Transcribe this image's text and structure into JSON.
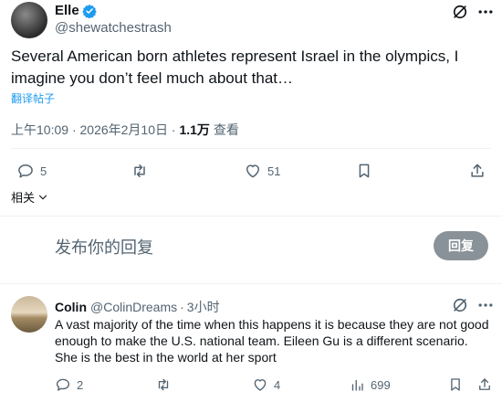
{
  "colors": {
    "accent": "#1d9bf0",
    "text": "#0f1419",
    "muted": "#536471",
    "divider": "#eff3f4",
    "reply_btn": "#8a9299"
  },
  "post": {
    "display_name": "Elle",
    "handle": "@shewatchestrash",
    "verified_icon": "verified-badge-icon",
    "text": "Several American born athletes represent Israel in the olympics, I imagine you don’t feel much about that…",
    "translate_label": "翻译帖子",
    "time": "上午10:09",
    "date": "2026年2月10日",
    "views_count": "1.1万",
    "views_label": "查看",
    "actions": {
      "replies": "5",
      "reposts": "",
      "likes": "51"
    },
    "related_label": "相关"
  },
  "compose": {
    "placeholder": "发布你的回复",
    "button_label": "回复"
  },
  "reply": {
    "display_name": "Colin",
    "handle": "@ColinDreams",
    "time": "3小时",
    "text": "A vast majority of the time when this happens it is because they are not good enough to make the U.S. national team. Eileen Gu is a different scenario. She is the best in the world at her sport",
    "actions": {
      "replies": "2",
      "reposts": "",
      "likes": "4",
      "views": "699"
    }
  }
}
